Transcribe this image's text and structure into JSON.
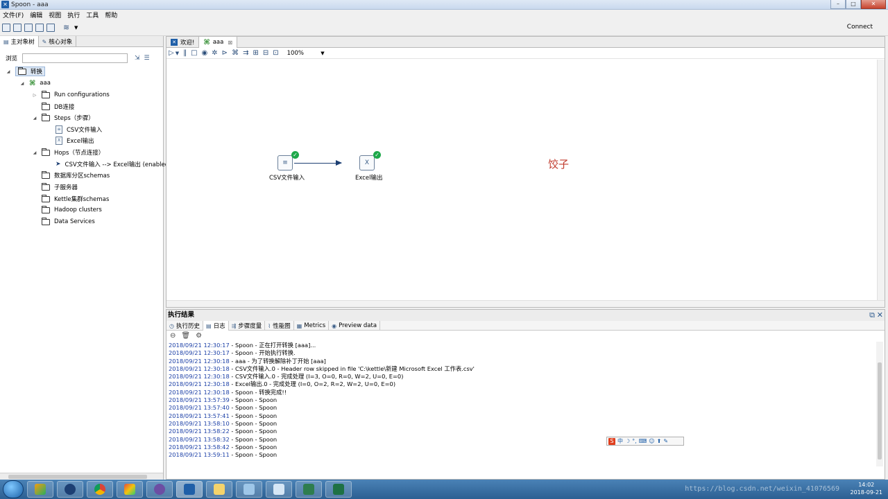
{
  "window": {
    "title": "Spoon - aaa",
    "buttons": [
      "–",
      "□",
      "✕"
    ]
  },
  "menu": [
    "文件(F)",
    "编辑",
    "视图",
    "执行",
    "工具",
    "帮助"
  ],
  "toolbar": {
    "connect_label": "Connect"
  },
  "left": {
    "tabs": [
      "主对象树",
      "核心对象"
    ],
    "browse_label": "浏览",
    "browse_value": "",
    "tree": {
      "root": "转换",
      "trans": "aaa",
      "items": [
        "Run configurations",
        "DB连接",
        "Steps（步骤）",
        "CSV文件输入",
        "Excel输出",
        "Hops（节点连接）",
        "CSV文件输入 --> Excel输出 (enabled)",
        "数据库分区schemas",
        "子服务器",
        "Kettle集群schemas",
        "Hadoop clusters",
        "Data Services"
      ]
    }
  },
  "editor": {
    "tabs": [
      "欢迎!",
      "aaa"
    ],
    "zoom": "100%",
    "steps": [
      {
        "label": "CSV文件输入",
        "status": "ok"
      },
      {
        "label": "Excel输出",
        "status": "ok"
      }
    ],
    "note": "饺子"
  },
  "results": {
    "title": "执行结果",
    "tabs": [
      "执行历史",
      "日志",
      "步骤度量",
      "性能图",
      "Metrics",
      "Preview data"
    ],
    "log": [
      {
        "ts": "2018/09/21 12:30:17",
        "msg": " - Spoon - 正在打开转换 [aaa]..."
      },
      {
        "ts": "2018/09/21 12:30:17",
        "msg": " - Spoon - 开始执行转换."
      },
      {
        "ts": "2018/09/21 12:30:18",
        "msg": " - aaa - 为了转换解除补丁开始  [aaa]"
      },
      {
        "ts": "2018/09/21 12:30:18",
        "msg": " - CSV文件输入.0 - Header row skipped in file 'C:\\kettle\\新建 Microsoft Excel 工作表.csv'"
      },
      {
        "ts": "2018/09/21 12:30:18",
        "msg": " - CSV文件输入.0 - 完成处理 (I=3, O=0, R=0, W=2, U=0, E=0)"
      },
      {
        "ts": "2018/09/21 12:30:18",
        "msg": " - Excel输出.0 - 完成处理 (I=0, O=2, R=2, W=2, U=0, E=0)"
      },
      {
        "ts": "2018/09/21 12:30:18",
        "msg": " - Spoon - 转换完成!!"
      },
      {
        "ts": "2018/09/21 13:57:39",
        "msg": " - Spoon - Spoon"
      },
      {
        "ts": "2018/09/21 13:57:40",
        "msg": " - Spoon - Spoon"
      },
      {
        "ts": "2018/09/21 13:57:41",
        "msg": " - Spoon - Spoon"
      },
      {
        "ts": "2018/09/21 13:58:10",
        "msg": " - Spoon - Spoon"
      },
      {
        "ts": "2018/09/21 13:58:22",
        "msg": " - Spoon - Spoon"
      },
      {
        "ts": "2018/09/21 13:58:32",
        "msg": " - Spoon - Spoon"
      },
      {
        "ts": "2018/09/21 13:58:42",
        "msg": " - Spoon - Spoon"
      },
      {
        "ts": "2018/09/21 13:59:11",
        "msg": " - Spoon - Spoon"
      }
    ]
  },
  "ime": {
    "label": "中"
  },
  "taskbar": {
    "time": "14:02",
    "date": "2018-09-21",
    "watermark": "https://blog.csdn.net/weixin_41076569"
  },
  "colors": {
    "log_timestamp": "#1a3ea6",
    "note": "#c0392b",
    "ok_badge": "#1ea84a"
  }
}
